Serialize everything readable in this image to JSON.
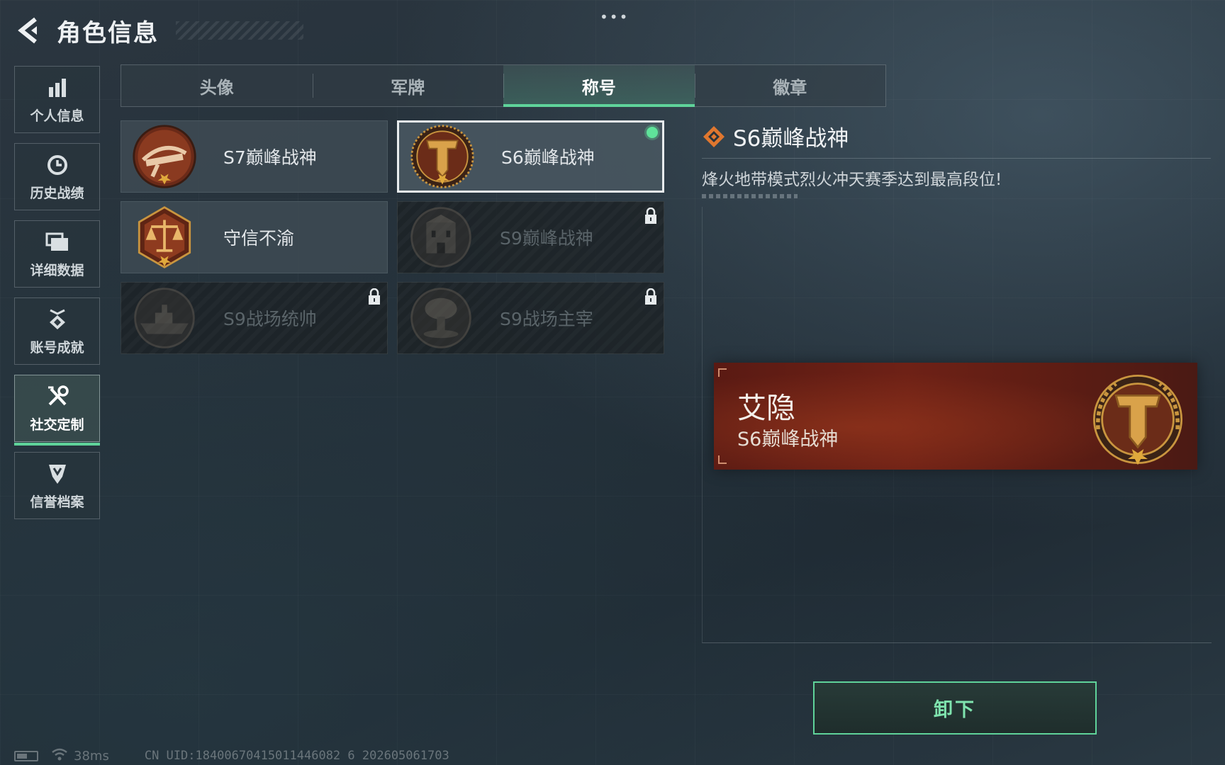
{
  "header": {
    "title": "角色信息"
  },
  "sidebar": {
    "items": [
      {
        "label": "个人信息",
        "icon": "bar-chart-icon"
      },
      {
        "label": "历史战绩",
        "icon": "clock-icon"
      },
      {
        "label": "详细数据",
        "icon": "folder-icon"
      },
      {
        "label": "账号成就",
        "icon": "achievement-icon"
      },
      {
        "label": "社交定制",
        "icon": "tools-icon",
        "active": true
      },
      {
        "label": "信誉档案",
        "icon": "shield-icon"
      }
    ]
  },
  "tabs": [
    {
      "label": "头像"
    },
    {
      "label": "军牌"
    },
    {
      "label": "称号",
      "active": true
    },
    {
      "label": "徽章"
    }
  ],
  "titles": [
    {
      "name": "S7巅峰战神",
      "badge": "crossbow-badge",
      "locked": false
    },
    {
      "name": "S6巅峰战神",
      "badge": "t-shield-badge",
      "locked": false,
      "selected": true,
      "equipped": true
    },
    {
      "name": "守信不渝",
      "badge": "scales-badge",
      "locked": false
    },
    {
      "name": "S9巅峰战神",
      "badge": "building-badge",
      "locked": true
    },
    {
      "name": "S9战场统帅",
      "badge": "ship-badge",
      "locked": true
    },
    {
      "name": "S9战场主宰",
      "badge": "mushroom-cloud-badge",
      "locked": true
    }
  ],
  "detail": {
    "title": "S6巅峰战神",
    "description": "烽火地带模式烈火冲天赛季达到最高段位!"
  },
  "preview": {
    "player_name": "艾隐",
    "title": "S6巅峰战神"
  },
  "actions": {
    "unequip_label": "卸下"
  },
  "status": {
    "ping": "38ms",
    "uid": "CN UID:18400670415011446082 6 202605061703"
  },
  "colors": {
    "accent": "#5fd39a",
    "badge_gold": "#c9953f",
    "badge_bronze": "#8a3a20",
    "preview_red": "#6e2116"
  }
}
